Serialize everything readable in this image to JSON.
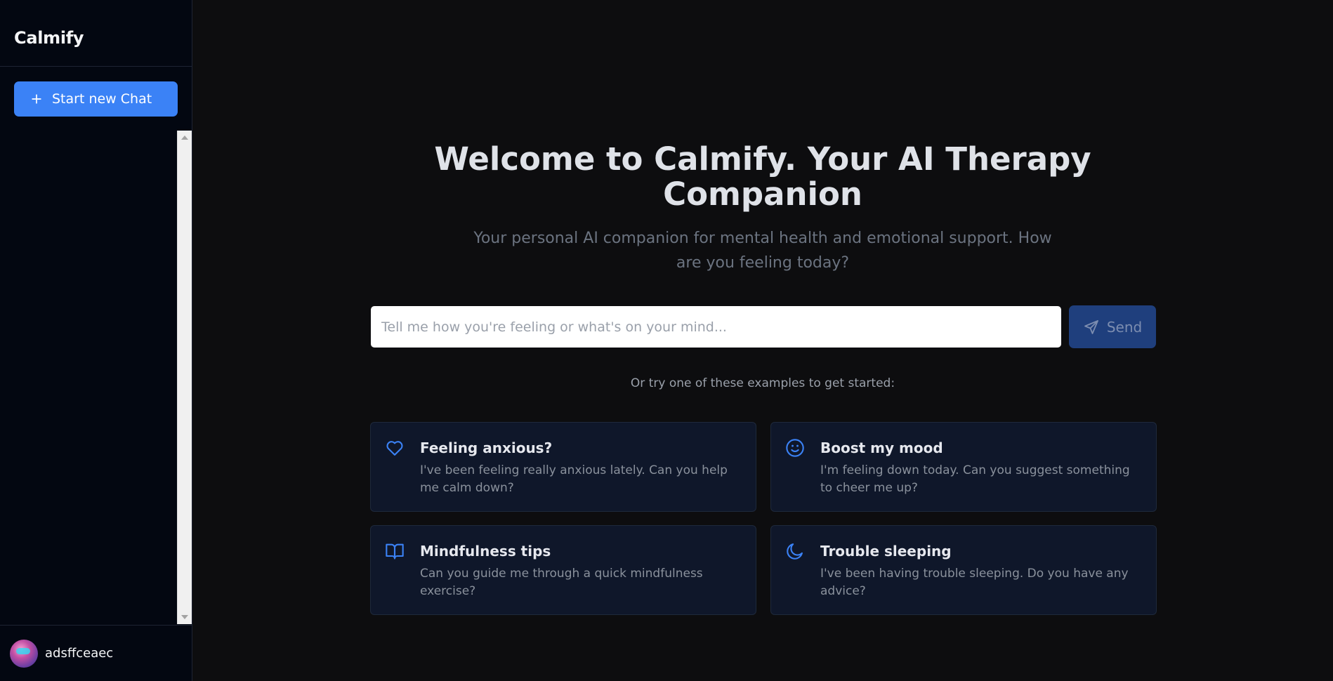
{
  "sidebar": {
    "brand": "Calmify",
    "new_chat_label": "Start new Chat",
    "user": {
      "name": "adsffceaec"
    }
  },
  "main": {
    "title": "Welcome to Calmify. Your AI Therapy Companion",
    "subtitle": "Your personal AI companion for mental health and emotional support. How are you feeling today?",
    "input": {
      "placeholder": "Tell me how you're feeling or what's on your mind...",
      "value": ""
    },
    "send_label": "Send",
    "examples_label": "Or try one of these examples to get started:",
    "examples": [
      {
        "icon": "heart-icon",
        "title": "Feeling anxious?",
        "description": "I've been feeling really anxious lately. Can you help me calm down?"
      },
      {
        "icon": "smile-icon",
        "title": "Boost my mood",
        "description": "I'm feeling down today. Can you suggest something to cheer me up?"
      },
      {
        "icon": "book-open-icon",
        "title": "Mindfulness tips",
        "description": "Can you guide me through a quick mindfulness exercise?"
      },
      {
        "icon": "moon-icon",
        "title": "Trouble sleeping",
        "description": "I've been having trouble sleeping. Do you have any advice?"
      }
    ]
  },
  "colors": {
    "accent": "#3b82f6",
    "send_button": "#1f3f7d",
    "card_background": "#0f172a",
    "sidebar_background": "#030711",
    "main_background": "#0d0d0f"
  }
}
